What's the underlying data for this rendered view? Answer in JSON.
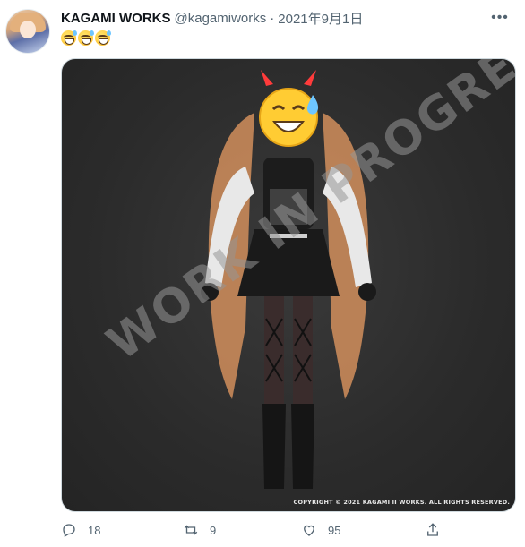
{
  "author": {
    "display_name": "KAGAMI WORKS",
    "handle": "@kagamiworks",
    "separator": "·",
    "date": "2021年9月1日"
  },
  "tweet": {
    "emoji_icons": [
      "sweat-smile-emoji",
      "sweat-smile-emoji",
      "sweat-smile-emoji"
    ],
    "more_icon": "more-horizontal-icon"
  },
  "media": {
    "watermark": "WORK IN PROGRESS",
    "copyright": "COPYRIGHT  ©  2021 KAGAMI II WORKS. ALL RIGHTS RESERVED.",
    "background_color": "#2b2b2b"
  },
  "actions": {
    "reply": {
      "icon": "reply-icon",
      "count": "18"
    },
    "retweet": {
      "icon": "retweet-icon",
      "count": "9"
    },
    "like": {
      "icon": "heart-icon",
      "count": "95"
    },
    "share": {
      "icon": "share-icon"
    }
  },
  "colors": {
    "text_primary": "#0f1419",
    "text_secondary": "#536471",
    "border": "#cfd9de"
  }
}
